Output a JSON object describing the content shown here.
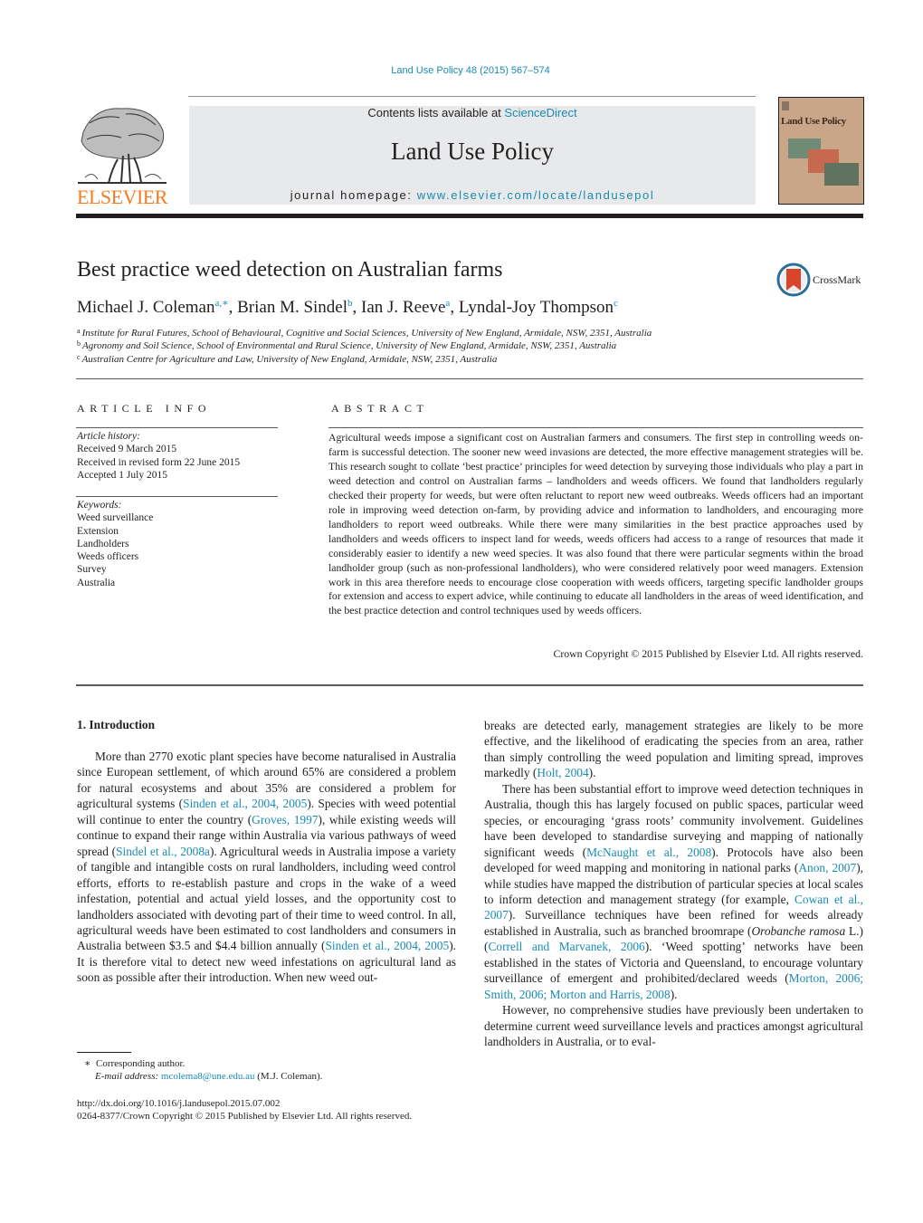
{
  "header": {
    "journal_ref": "Land Use Policy 48 (2015) 567–574",
    "contents_prefix": "Contents lists available at ",
    "contents_link": "ScienceDirect",
    "journal_title": "Land Use Policy",
    "homepage_prefix": "journal homepage: ",
    "homepage_link": "www.elsevier.com/locate/landusepol",
    "publisher_logo_text": "ELSEVIER",
    "cover_title": "Land Use Policy",
    "crossmark_label": "CrossMark"
  },
  "colors": {
    "link": "#1a8bb3",
    "elsevier_orange": "#f47b20",
    "banner_gray": "#e8e9ea",
    "cover_tan": "#c9a687",
    "crossmark_red": "#d9442a",
    "crossmark_blue": "#2a6f97"
  },
  "article": {
    "title": "Best practice weed detection on Australian farms",
    "authors": [
      {
        "name": "Michael J. Coleman",
        "sup": "a,∗"
      },
      {
        "name": "Brian M. Sindel",
        "sup": "b"
      },
      {
        "name": "Ian J. Reeve",
        "sup": "a"
      },
      {
        "name": "Lyndal-Joy Thompson",
        "sup": "c"
      }
    ],
    "affiliations": [
      {
        "key": "a",
        "text": "Institute for Rural Futures, School of Behavioural, Cognitive and Social Sciences, University of New England, Armidale, NSW, 2351, Australia"
      },
      {
        "key": "b",
        "text": "Agronomy and Soil Science, School of Environmental and Rural Science, University of New England, Armidale, NSW, 2351, Australia"
      },
      {
        "key": "c",
        "text": "Australian Centre for Agriculture and Law, University of New England, Armidale, NSW, 2351, Australia"
      }
    ]
  },
  "article_info": {
    "heading": "ARTICLE INFO",
    "history_label": "Article history:",
    "history": [
      "Received 9 March 2015",
      "Received in revised form 22 June 2015",
      "Accepted 1 July 2015"
    ],
    "keywords_label": "Keywords:",
    "keywords": [
      "Weed surveillance",
      "Extension",
      "Landholders",
      "Weeds officers",
      "Survey",
      "Australia"
    ]
  },
  "abstract": {
    "heading": "ABSTRACT",
    "text": "Agricultural weeds impose a significant cost on Australian farmers and consumers. The first step in controlling weeds on-farm is successful detection. The sooner new weed invasions are detected, the more effective management strategies will be. This research sought to collate ‘best practice’ principles for weed detection by surveying those individuals who play a part in weed detection and control on Australian farms – landholders and weeds officers. We found that landholders regularly checked their property for weeds, but were often reluctant to report new weed outbreaks. Weeds officers had an important role in improving weed detection on-farm, by providing advice and information to landholders, and encouraging more landholders to report weed outbreaks. While there were many similarities in the best practice approaches used by landholders and weeds officers to inspect land for weeds, weeds officers had access to a range of resources that made it considerably easier to identify a new weed species. It was also found that there were particular segments within the broad landholder group (such as non-professional landholders), who were considered relatively poor weed managers. Extension work in this area therefore needs to encourage close cooperation with weeds officers, targeting specific landholder groups for extension and access to expert advice, while continuing to educate all landholders in the areas of weed identification, and the best practice detection and control techniques used by weeds officers.",
    "copyright": "Crown Copyright © 2015 Published by Elsevier Ltd. All rights reserved."
  },
  "body": {
    "section_heading": "1.  Introduction",
    "left_p1": {
      "t1": "More than 2770 exotic plant species have become naturalised in Australia since European settlement, of which around 65% are considered a problem for natural ecosystems and about 35% are considered a problem for agricultural systems (",
      "c1": "Sinden et al., 2004, 2005",
      "t2": "). Species with weed potential will continue to enter the country (",
      "c2": "Groves, 1997",
      "t3": "), while existing weeds will continue to expand their range within Australia via various pathways of weed spread (",
      "c3": "Sindel et al., 2008a",
      "t4": "). Agricultural weeds in Australia impose a variety of tangible and intangible costs on rural landholders, including weed control efforts, efforts to re-establish pasture and crops in the wake of a weed infestation, potential and actual yield losses, and the opportunity cost to landholders associated with devoting part of their time to weed control. In all, agricultural weeds have been estimated to cost landholders and consumers in Australia between $3.5 and $4.4 billion annually (",
      "c4": "Sinden et al., 2004, 2005",
      "t5": "). It is therefore vital to detect new weed infestations on agricultural land as soon as possible after their introduction. When new weed out-"
    },
    "right_p1": {
      "t1": "breaks are detected early, management strategies are likely to be more effective, and the likelihood of eradicating the species from an area, rather than simply controlling the weed population and limiting spread, improves markedly (",
      "c1": "Holt, 2004",
      "t2": ")."
    },
    "right_p2": {
      "t1": "There has been substantial effort to improve weed detection techniques in Australia, though this has largely focused on public spaces, particular weed species, or encouraging ‘grass roots’ community involvement. Guidelines have been developed to standardise surveying and mapping of nationally significant weeds (",
      "c1": "McNaught et al., 2008",
      "t2": "). Protocols have also been developed for weed mapping and monitoring in national parks (",
      "c2": "Anon, 2007",
      "t3": "), while studies have mapped the distribution of particular species at local scales to inform detection and management strategy (for example, ",
      "c3": "Cowan et al., 2007",
      "t4": "). Surveillance techniques have been refined for weeds already established in Australia, such as branched broomrape (",
      "i1": "Orobanche ramosa",
      "t5": " L.) (",
      "c4": "Correll and Marvanek, 2006",
      "t6": "). ‘Weed spotting’ networks have been established in the states of Victoria and Queensland, to encourage voluntary surveillance of emergent and prohibited/declared weeds (",
      "c5": "Morton, 2006; Smith, 2006; Morton and Harris, 2008",
      "t7": ")."
    },
    "right_p3": {
      "t1": "However, no comprehensive studies have previously been undertaken to determine current weed surveillance levels and practices amongst agricultural landholders in Australia, or to eval-"
    }
  },
  "footnotes": {
    "star": "∗",
    "corresponding": "Corresponding author.",
    "email_label": "E-mail address: ",
    "email": "mcolema8@une.edu.au",
    "email_suffix": " (M.J. Coleman).",
    "doi": "http://dx.doi.org/10.1016/j.landusepol.2015.07.002",
    "issn_copyright": "0264-8377/Crown Copyright © 2015 Published by Elsevier Ltd. All rights reserved."
  }
}
